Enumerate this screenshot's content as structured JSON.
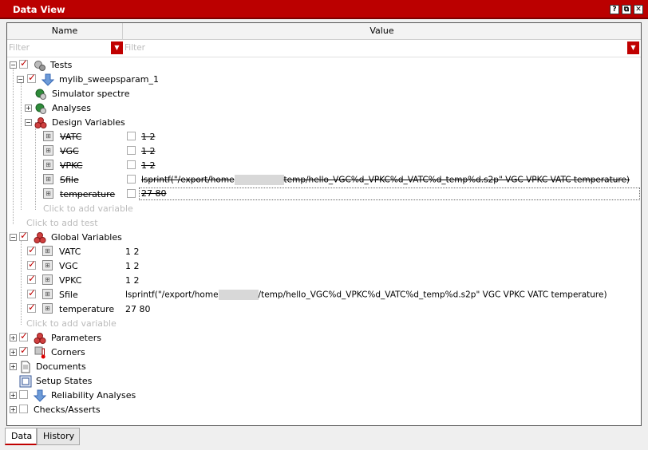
{
  "window": {
    "title": "Data View",
    "buttons": [
      "?",
      "⧉",
      "✕"
    ]
  },
  "columns": {
    "name": "Name",
    "value": "Value"
  },
  "filters": {
    "name_placeholder": "Filter",
    "value_placeholder": "Filter"
  },
  "tree": {
    "tests": "Tests",
    "test_name": "mylib_sweepsparam_1",
    "simulator": "Simulator  spectre",
    "analyses": "Analyses",
    "design_variables": "Design Variables",
    "design_vars": [
      {
        "name": "VATC",
        "value": "1 2"
      },
      {
        "name": "VGC",
        "value": "1 2"
      },
      {
        "name": "VPKC",
        "value": "1 2"
      },
      {
        "name": "Sfile",
        "value_prefix": "lsprintf(\"/export/home",
        "value_suffix": "temp/hello_VGC%d_VPKC%d_VATC%d_temp%d.s2p\" VGC VPKC VATC temperature)"
      },
      {
        "name": "temperature",
        "value": "27 80"
      }
    ],
    "click_add_variable": "Click to add variable",
    "click_add_test": "Click to add test",
    "global_variables": "Global Variables",
    "global_vars": [
      {
        "name": "VATC",
        "value": "1 2"
      },
      {
        "name": "VGC",
        "value": "1 2"
      },
      {
        "name": "VPKC",
        "value": "1 2"
      },
      {
        "name": "Sfile",
        "value_prefix": "lsprintf(\"/export/home",
        "value_suffix": "/temp/hello_VGC%d_VPKC%d_VATC%d_temp%d.s2p\" VGC VPKC VATC temperature)"
      },
      {
        "name": "temperature",
        "value": "27 80"
      }
    ],
    "click_add_variable_2": "Click to add variable",
    "parameters": "Parameters",
    "corners": "Corners",
    "documents": "Documents",
    "setup_states": "Setup States",
    "reliability": "Reliability Analyses",
    "checks": "Checks/Asserts"
  },
  "tabs": [
    "Data",
    "History"
  ],
  "colors": {
    "titlebar": "#bb0000",
    "accent": "#c00000"
  }
}
